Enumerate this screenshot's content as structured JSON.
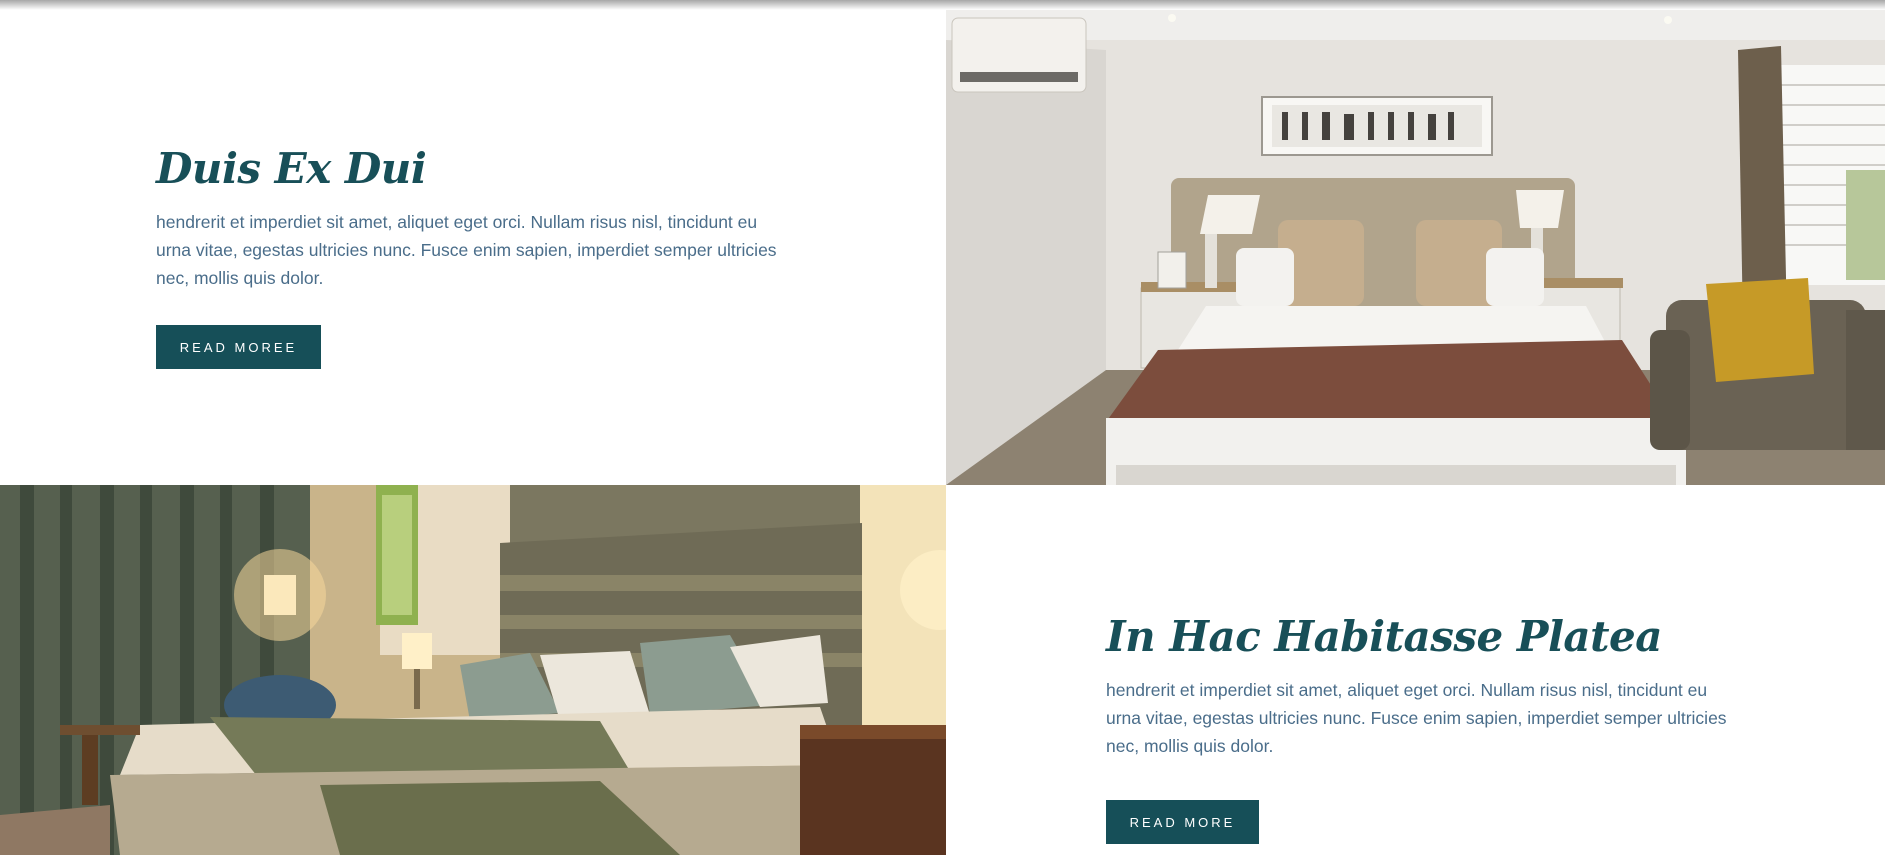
{
  "sections": [
    {
      "heading": "Duis Ex Dui",
      "body": "hendrerit et imperdiet sit amet, aliquet eget orci. Nullam risus nisl, tincidunt eu urna vitae, egestas ultricies nunc. Fusce enim sapien, imperdiet semper ultricies nec, mollis quis dolor.",
      "button_label": "READ MOREE",
      "image": "bedroom-photo"
    },
    {
      "heading": "In Hac Habitasse Platea",
      "body": "hendrerit et imperdiet sit amet, aliquet eget orci. Nullam risus nisl, tincidunt eu urna vitae, egestas ultricies nunc. Fusce enim sapien, imperdiet semper ultricies nec, mollis quis dolor.",
      "button_label": "READ MORE",
      "image": "hotel-room-photo"
    }
  ],
  "colors": {
    "heading": "#184f58",
    "body_text": "#4a6d8a",
    "button_bg": "#164f58",
    "button_text": "#ffffff"
  }
}
